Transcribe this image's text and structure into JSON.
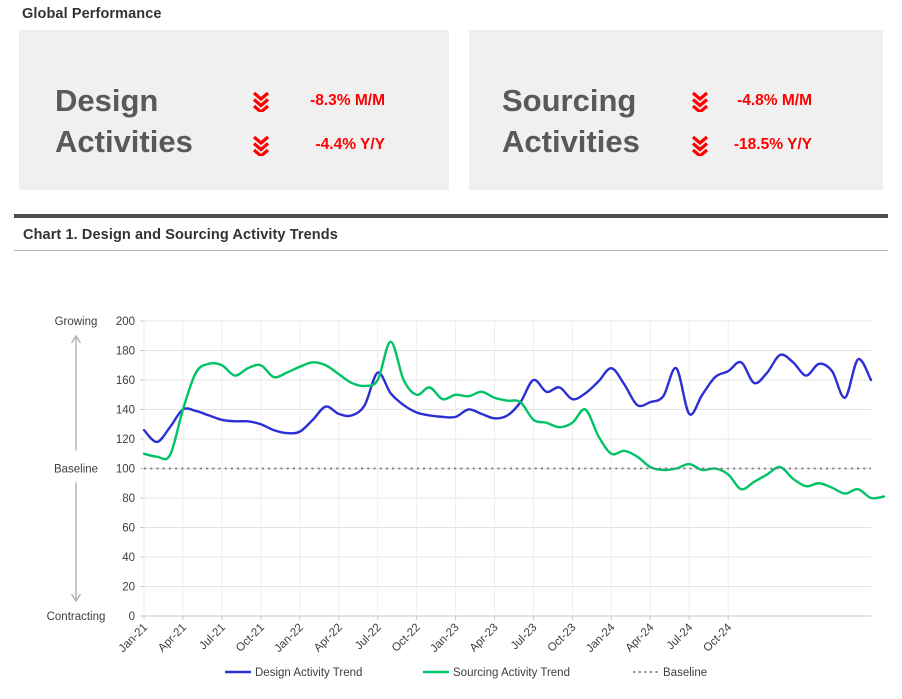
{
  "header": {
    "title": "Global Performance"
  },
  "kpi_cards": [
    {
      "id": "design",
      "label": "Design\nActivities",
      "icon": "triple-chevron-down-icon",
      "metrics": [
        {
          "value": "-8.3% M/M",
          "direction": "down"
        },
        {
          "value": "-4.4% Y/Y",
          "direction": "down"
        }
      ]
    },
    {
      "id": "sourcing",
      "label": "Sourcing\nActivities",
      "icon": "triple-chevron-down-icon",
      "metrics": [
        {
          "value": "-4.8% M/M",
          "direction": "down"
        },
        {
          "value": "-18.5% Y/Y",
          "direction": "down"
        }
      ]
    }
  ],
  "chart_panel": {
    "title": "Chart 1. Design and Sourcing Activity Trends"
  },
  "colors": {
    "design": "#2b2fd4",
    "sourcing": "#00c267",
    "baseline": "#7a7a7a",
    "negative": "#ff0000",
    "card_bg": "#f0f0f0",
    "rule_dark": "#4d4d4d",
    "text": "#333333"
  },
  "chart_data": {
    "type": "line",
    "title": "Chart 1. Design and Sourcing Activity Trends",
    "xlabel": "",
    "ylabel": "",
    "ylim": [
      0,
      200
    ],
    "yticks": [
      0,
      20,
      40,
      60,
      80,
      100,
      120,
      140,
      160,
      180,
      200
    ],
    "grid": true,
    "legend_position": "bottom",
    "annotations": [
      {
        "text": "Growing",
        "position": "top-left-axis"
      },
      {
        "text": "Baseline",
        "position": "mid-left-axis"
      },
      {
        "text": "Contracting",
        "position": "bottom-left-axis"
      }
    ],
    "x_tick_labels": [
      "Jan-21",
      "Apr-21",
      "Jul-21",
      "Oct-21",
      "Jan-22",
      "Apr-22",
      "Jul-22",
      "Oct-22",
      "Jan-23",
      "Apr-23",
      "Jul-23",
      "Oct-23",
      "Jan-24",
      "Apr-24",
      "Jul-24",
      "Oct-24"
    ],
    "x": [
      "Jan-21",
      "Feb-21",
      "Mar-21",
      "Apr-21",
      "May-21",
      "Jun-21",
      "Jul-21",
      "Aug-21",
      "Sep-21",
      "Oct-21",
      "Nov-21",
      "Dec-21",
      "Jan-22",
      "Feb-22",
      "Mar-22",
      "Apr-22",
      "May-22",
      "Jun-22",
      "Jul-22",
      "Aug-22",
      "Sep-22",
      "Oct-22",
      "Nov-22",
      "Dec-22",
      "Jan-23",
      "Feb-23",
      "Mar-23",
      "Apr-23",
      "May-23",
      "Jun-23",
      "Jul-23",
      "Aug-23",
      "Sep-23",
      "Oct-23",
      "Nov-23",
      "Dec-23",
      "Jan-24",
      "Feb-24",
      "Mar-24",
      "Apr-24",
      "May-24",
      "Jun-24",
      "Jul-24",
      "Aug-24",
      "Sep-24",
      "Oct-24",
      "Nov-24",
      "Dec-24"
    ],
    "series": [
      {
        "name": "Design Activity Trend",
        "color": "#2b2fd4",
        "style": "solid",
        "values": [
          126,
          118,
          128,
          140,
          139,
          136,
          133,
          132,
          132,
          130,
          126,
          124,
          125,
          133,
          142,
          137,
          136,
          143,
          165,
          151,
          143,
          138,
          136,
          135,
          135,
          140,
          137,
          134,
          136,
          145,
          160,
          152,
          155,
          147,
          151,
          159,
          168,
          157,
          143,
          145,
          149,
          168,
          137,
          150,
          162,
          166,
          172,
          158,
          165,
          177,
          172,
          163,
          171,
          166,
          148,
          174,
          160
        ]
      },
      {
        "name": "Sourcing Activity Trend",
        "color": "#00c267",
        "style": "solid",
        "values": [
          110,
          108,
          109,
          140,
          165,
          171,
          170,
          163,
          168,
          170,
          162,
          165,
          169,
          172,
          170,
          164,
          158,
          156,
          160,
          186,
          160,
          150,
          155,
          147,
          150,
          149,
          152,
          148,
          146,
          145,
          133,
          131,
          128,
          131,
          140,
          122,
          110,
          112,
          108,
          101,
          99,
          100,
          103,
          99,
          100,
          96,
          86,
          91,
          96,
          101,
          93,
          88,
          90,
          87,
          83,
          86,
          80,
          81
        ]
      },
      {
        "name": "Baseline",
        "color": "#7a7a7a",
        "style": "dotted",
        "constant": 100
      }
    ],
    "legend": [
      {
        "label": "Design Activity Trend",
        "color": "#2b2fd4",
        "style": "solid"
      },
      {
        "label": "Sourcing Activity Trend",
        "color": "#00c267",
        "style": "solid"
      },
      {
        "label": "Baseline",
        "color": "#7a7a7a",
        "style": "dotted"
      }
    ]
  }
}
